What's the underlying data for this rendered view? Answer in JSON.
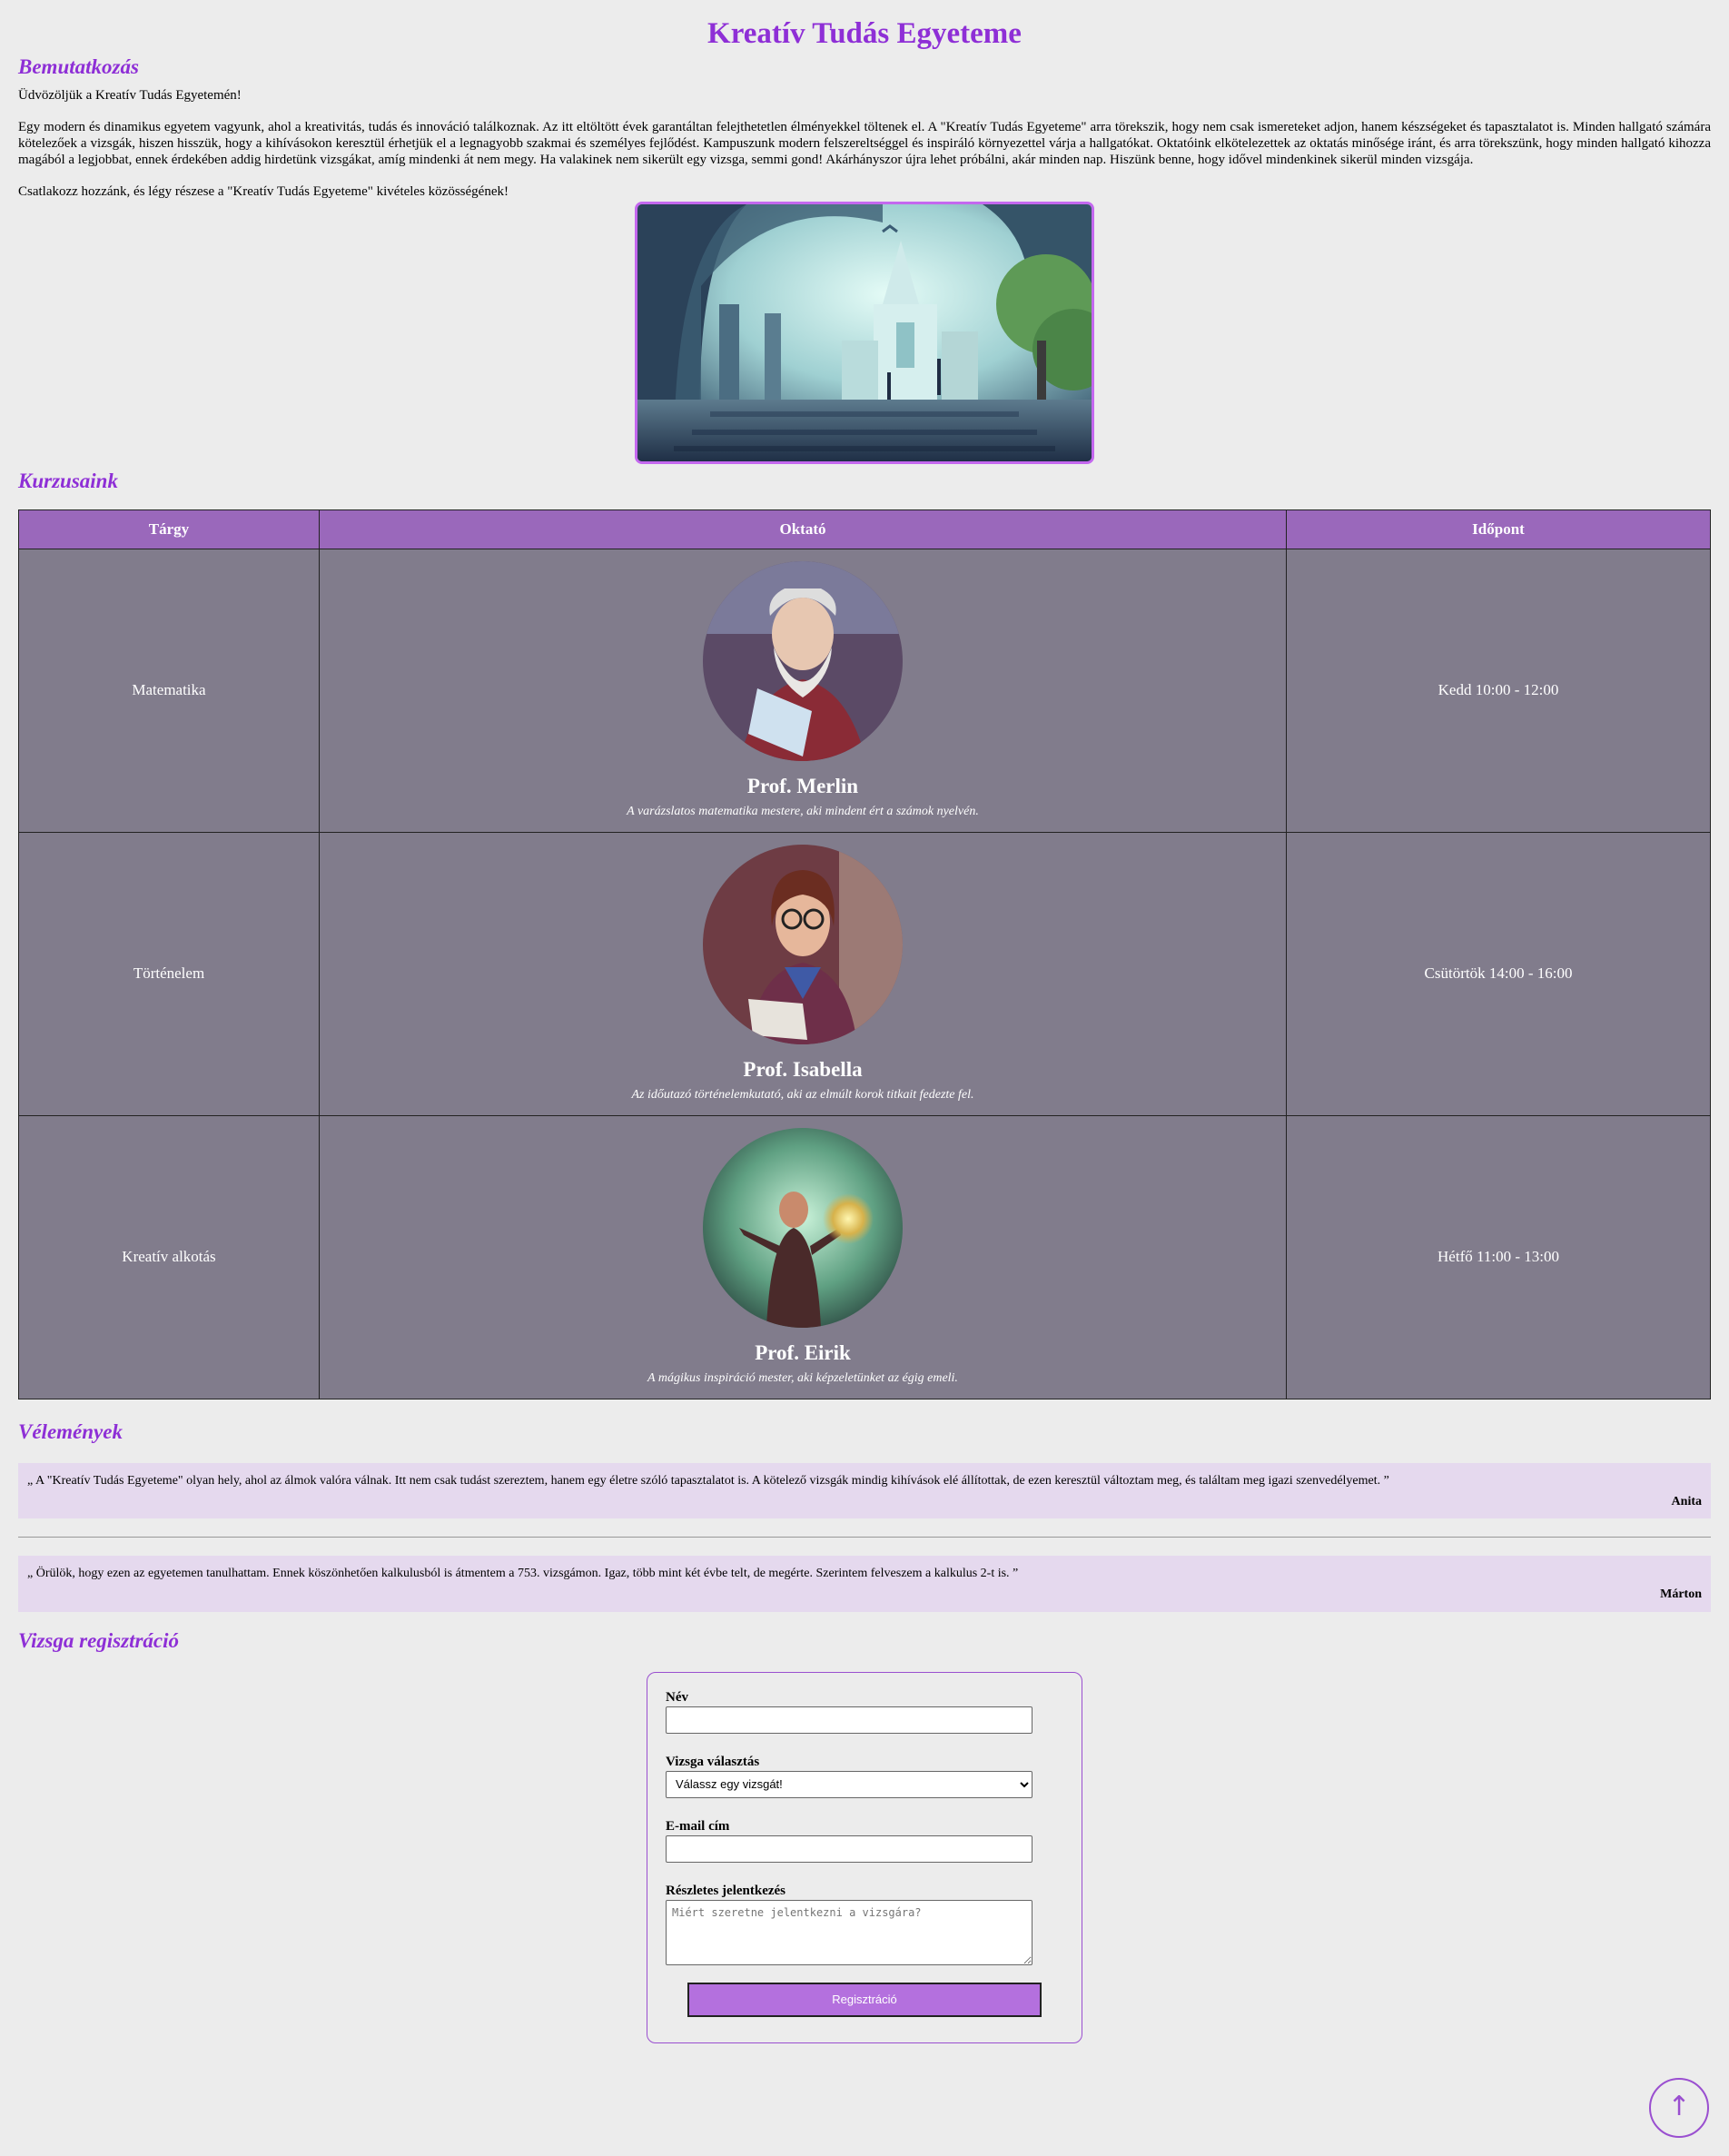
{
  "title": "Kreatív Tudás Egyeteme",
  "intro": {
    "heading": "Bemutatkozás",
    "p1": "Üdvözöljük a Kreatív Tudás Egyetemén!",
    "p2": "Egy modern és dinamikus egyetem vagyunk, ahol a kreativitás, tudás és innováció találkoznak. Az itt eltöltött évek garantáltan felejthetetlen élményekkel töltenek el. A \"Kreatív Tudás Egyeteme\" arra törekszik, hogy nem csak ismereteket adjon, hanem készségeket és tapasztalatot is. Minden hallgató számára kötelezőek a vizsgák, hiszen hisszük, hogy a kihívásokon keresztül érhetjük el a legnagyobb szakmai és személyes fejlődést. Kampuszunk modern felszereltséggel és inspiráló környezettel várja a hallgatókat. Oktatóink elkötelezettek az oktatás minősége iránt, és arra törekszünk, hogy minden hallgató kihozza magából a legjobbat, ennek érdekében addig hirdetünk vizsgákat, amíg mindenki át nem megy. Ha valakinek nem sikerült egy vizsga, semmi gond! Akárhányszor újra lehet próbálni, akár minden nap. Hiszünk benne, hogy idővel mindenkinek sikerül minden vizsgája.",
    "p3": "Csatlakozz hozzánk, és légy részese a \"Kreatív Tudás Egyeteme\" kivételes közösségének!"
  },
  "courses": {
    "heading": "Kurzusaink",
    "columns": [
      "Tárgy",
      "Oktató",
      "Időpont"
    ],
    "rows": [
      {
        "subject": "Matematika",
        "name": "Prof. Merlin",
        "desc": "A varázslatos matematika mestere, aki mindent ért a számok nyelvén.",
        "time": "Kedd 10:00 - 12:00"
      },
      {
        "subject": "Történelem",
        "name": "Prof. Isabella",
        "desc": "Az időutazó történelemkutató, aki az elmúlt korok titkait fedezte fel.",
        "time": "Csütörtök 14:00 - 16:00"
      },
      {
        "subject": "Kreatív alkotás",
        "name": "Prof. Eirik",
        "desc": "A mágikus inspiráció mester, aki képzeletünket az égig emeli.",
        "time": "Hétfő 11:00 - 13:00"
      }
    ]
  },
  "reviews": {
    "heading": "Vélemények",
    "items": [
      {
        "text": "„ A \"Kreatív Tudás Egyeteme\" olyan hely, ahol az álmok valóra válnak. Itt nem csak tudást szereztem, hanem egy életre szóló tapasztalatot is. A kötelező vizsgák mindig kihívások elé állítottak, de ezen keresztül változtam meg, és találtam meg igazi szenvedélyemet. ”",
        "author": "Anita"
      },
      {
        "text": "„ Örülök, hogy ezen az egyetemen tanulhattam. Ennek köszönhetően kalkulusból is átmentem a 753. vizsgámon. Igaz, több mint két évbe telt, de megérte. Szerintem felveszem a kalkulus 2-t is. ”",
        "author": "Márton"
      }
    ]
  },
  "form": {
    "heading": "Vizsga regisztráció",
    "name_label": "Név",
    "exam_label": "Vizsga választás",
    "exam_selected": "Válassz egy vizsgát!",
    "email_label": "E-mail cím",
    "details_label": "Részletes jelentkezés",
    "details_placeholder": "Miért szeretne jelentkezni a vizsgára?",
    "submit_label": "Regisztráció"
  },
  "icons": {
    "back_to_top": "arrow-up-icon"
  },
  "colors": {
    "accent": "#8e2fd6",
    "table_header": "#9a68bb",
    "table_cell": "#817c8c",
    "review_bg": "#e5d9ee",
    "button": "#b470de"
  }
}
